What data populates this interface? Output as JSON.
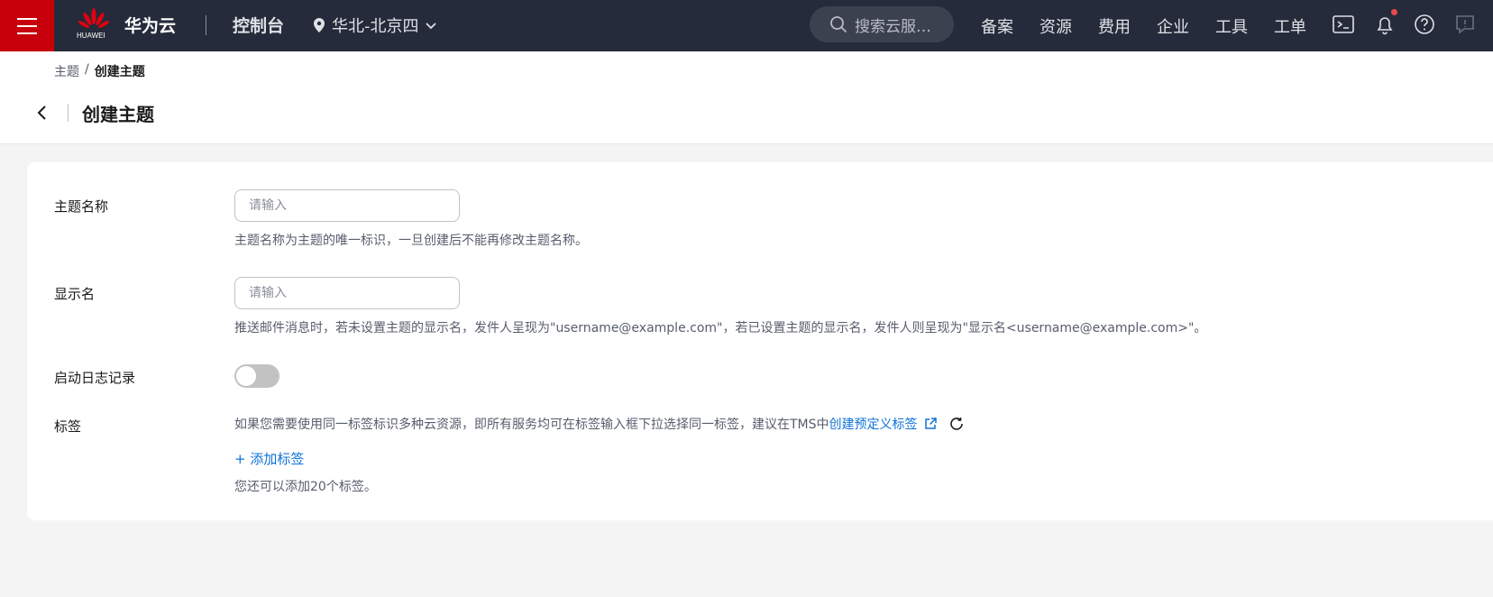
{
  "topbar": {
    "brand_logo_text": "HUAWEI",
    "brand": "华为云",
    "console": "控制台",
    "region": "华北-北京四",
    "search_placeholder": "搜索云服…",
    "nav": [
      "备案",
      "资源",
      "费用",
      "企业",
      "工具",
      "工单"
    ],
    "icons": [
      "terminal-icon",
      "bell-icon",
      "help-icon",
      "feedback-icon"
    ],
    "colors": {
      "bar": "#252b3a",
      "menu": "#c7000b"
    }
  },
  "breadcrumb": {
    "parent": "主题",
    "separator": "/",
    "current": "创建主题"
  },
  "page_title": "创建主题",
  "form": {
    "topic_name": {
      "label": "主题名称",
      "placeholder": "请输入",
      "value": "",
      "help": "主题名称为主题的唯一标识，一旦创建后不能再修改主题名称。"
    },
    "display_name": {
      "label": "显示名",
      "placeholder": "请输入",
      "value": "",
      "help": "推送邮件消息时，若未设置主题的显示名，发件人呈现为\"username@example.com\"，若已设置主题的显示名，发件人则呈现为\"显示名<username@example.com>\"。"
    },
    "logging": {
      "label": "启动日志记录",
      "enabled": false
    },
    "tags": {
      "label": "标签",
      "hint": "如果您需要使用同一标签标识多种云资源，即所有服务均可在标签输入框下拉选择同一标签，建议在TMS中",
      "link": "创建预定义标签",
      "add_label": "+ 添加标签",
      "remaining": "您还可以添加20个标签。"
    }
  }
}
